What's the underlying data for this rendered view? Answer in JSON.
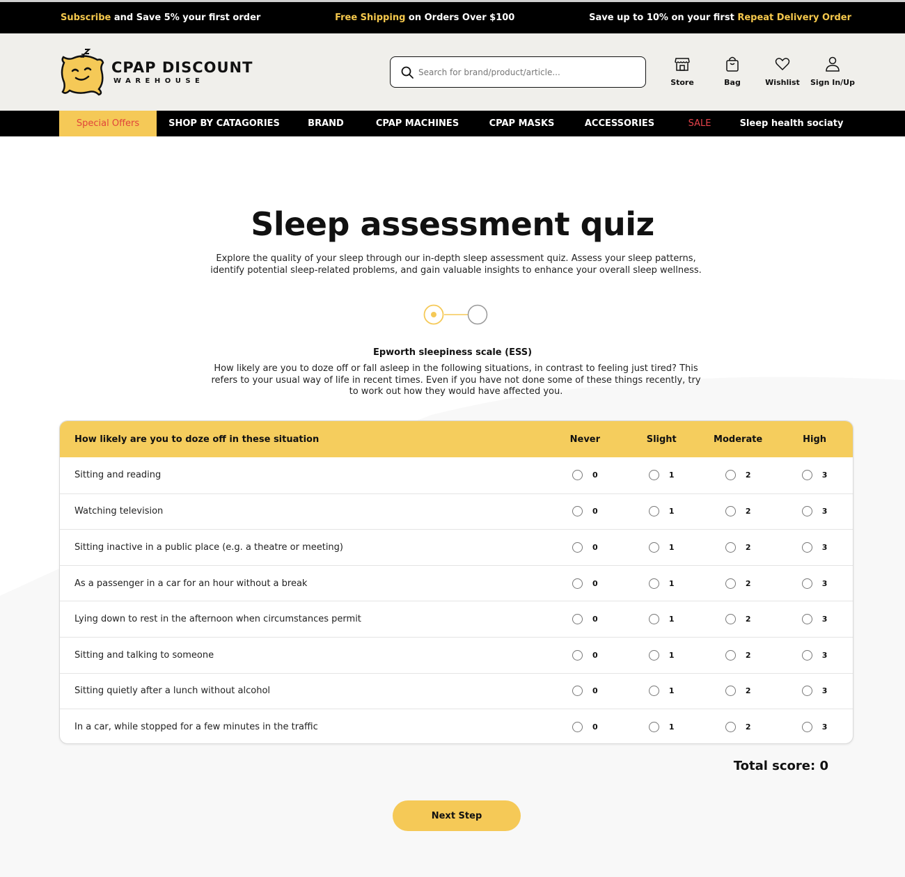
{
  "topbar": {
    "promo1_highlight": "Subscribe",
    "promo1_rest": " and Save 5% your first order",
    "promo2_highlight": "Free Shipping",
    "promo2_rest": " on Orders Over $100",
    "promo3_rest": "Save up to 10% on your first ",
    "promo3_highlight": "Repeat Delivery Order"
  },
  "brand": {
    "title": "CPAP DISCOUNT",
    "subtitle": "WAREHOUSE"
  },
  "search": {
    "placeholder": "Search for brand/product/article..."
  },
  "header_icons": [
    {
      "label": "Store",
      "icon": "store-icon"
    },
    {
      "label": "Bag",
      "icon": "bag-icon"
    },
    {
      "label": "Wishlist",
      "icon": "heart-icon"
    },
    {
      "label": "Sign In/Up",
      "icon": "user-icon"
    }
  ],
  "nav": [
    "Special Offers",
    "SHOP BY CATAGORIES",
    "BRAND",
    "CPAP MACHINES",
    "CPAP MASKS",
    "ACCESSORIES",
    "SALE",
    "Sleep health sociaty"
  ],
  "page": {
    "title": "Sleep assessment quiz",
    "intro": "Explore the quality of your sleep through our in-depth sleep assessment quiz. Assess your sleep patterns, identify potential sleep-related problems, and gain valuable insights to enhance your overall sleep wellness.",
    "current_step": 1,
    "total_steps": 2,
    "section_title": "Epworth sleepiness scale (ESS)",
    "section_desc": "How likely are you to doze off or fall asleep in the following situations, in contrast to feeling just tired? This refers to your usual way of life in recent times. Even if you have not done some of these things recently, try to work out how they would have affected you."
  },
  "quiz": {
    "header": "How likely are you to doze off in these situation",
    "columns": [
      "Never",
      "Slight",
      "Moderate",
      "High"
    ],
    "values": [
      "0",
      "1",
      "2",
      "3"
    ],
    "questions": [
      "Sitting and reading",
      "Watching television",
      "Sitting inactive in a public place (e.g. a theatre or meeting)",
      "As a passenger in a car for an hour without a break",
      "Lying down to rest in the afternoon when circumstances permit",
      "Sitting and talking to someone",
      "Sitting quietly after a lunch without alcohol",
      "In a car, while stopped for a few minutes in the traffic"
    ],
    "total_label": "Total score: 0"
  },
  "next_button": "Next Step",
  "colors": {
    "accent": "#f5c957",
    "sale": "#e8434b",
    "dark": "#000000"
  }
}
